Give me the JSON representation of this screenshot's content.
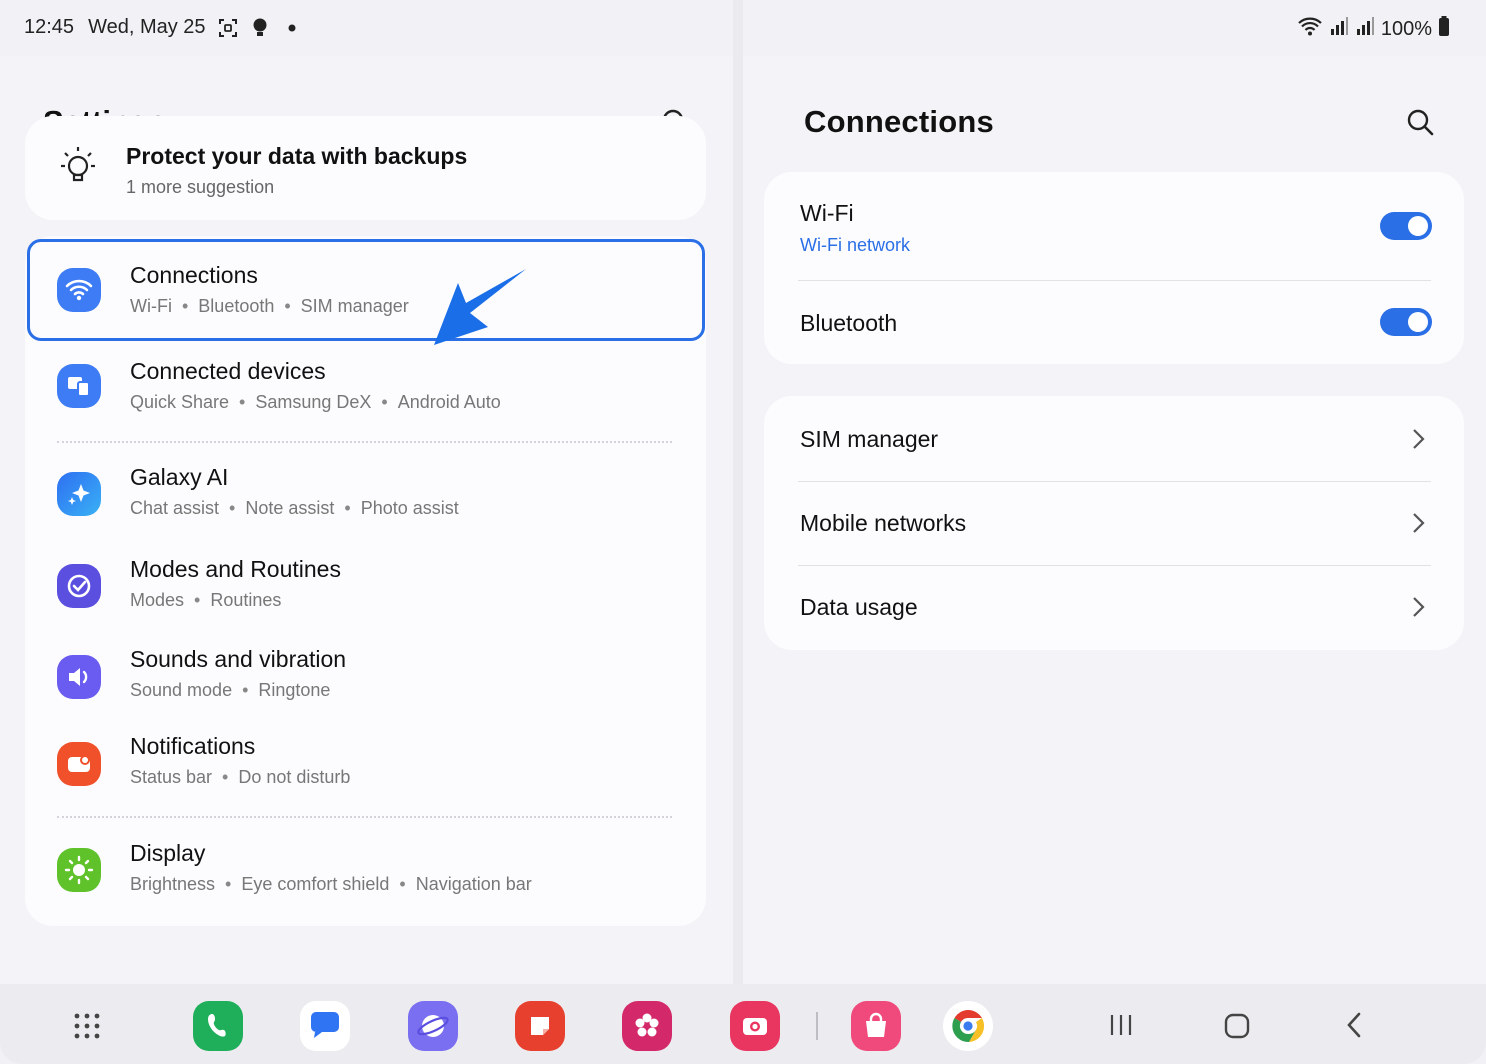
{
  "status_bar": {
    "time": "12:45",
    "date": "Wed, May 25",
    "battery": "100%",
    "icons": [
      "screenshot-icon",
      "bulb-icon",
      "dot-icon",
      "wifi-icon",
      "signal-icon",
      "signal-icon",
      "battery-icon"
    ]
  },
  "left_pane": {
    "title": "Settings",
    "suggestion": {
      "title": "Protect your data with backups",
      "subtitle": "1 more suggestion"
    },
    "items": [
      {
        "title": "Connections",
        "subs": [
          "Wi-Fi",
          "Bluetooth",
          "SIM manager"
        ],
        "icon": "wifi-icon",
        "color": "#3d7cf5"
      },
      {
        "title": "Connected devices",
        "subs": [
          "Quick Share",
          "Samsung DeX",
          "Android Auto"
        ],
        "icon": "devices-icon",
        "color": "#3d7cf5"
      },
      {
        "title": "Galaxy AI",
        "subs": [
          "Chat assist",
          "Note assist",
          "Photo assist"
        ],
        "icon": "sparkle-icon",
        "color": "#2f8cf5"
      },
      {
        "title": "Modes and Routines",
        "subs": [
          "Modes",
          "Routines"
        ],
        "icon": "check-circle-icon",
        "color": "#5b4fe0"
      },
      {
        "title": "Sounds and vibration",
        "subs": [
          "Sound mode",
          "Ringtone"
        ],
        "icon": "volume-icon",
        "color": "#6a5cf0"
      },
      {
        "title": "Notifications",
        "subs": [
          "Status bar",
          "Do not disturb"
        ],
        "icon": "notification-icon",
        "color": "#f0512a"
      },
      {
        "title": "Display",
        "subs": [
          "Brightness",
          "Eye comfort shield",
          "Navigation bar"
        ],
        "icon": "sun-icon",
        "color": "#5fc22a"
      }
    ]
  },
  "right_pane": {
    "title": "Connections",
    "wifi": {
      "title": "Wi-Fi",
      "subtitle": "Wi-Fi network",
      "on": true
    },
    "bluetooth": {
      "title": "Bluetooth",
      "on": true
    },
    "links": [
      "SIM manager",
      "Mobile networks",
      "Data usage"
    ]
  },
  "dock": {
    "apps": [
      "apps-grid-icon",
      "phone-icon",
      "messages-icon",
      "internet-icon",
      "notes-icon",
      "gallery-icon",
      "camera-icon",
      "store-icon",
      "chrome-icon"
    ],
    "nav": [
      "recents-icon",
      "home-icon",
      "back-icon"
    ]
  },
  "colors": {
    "accent": "#2a6fe6",
    "background": "#f2f2f6",
    "card": "#fcfcfe"
  }
}
